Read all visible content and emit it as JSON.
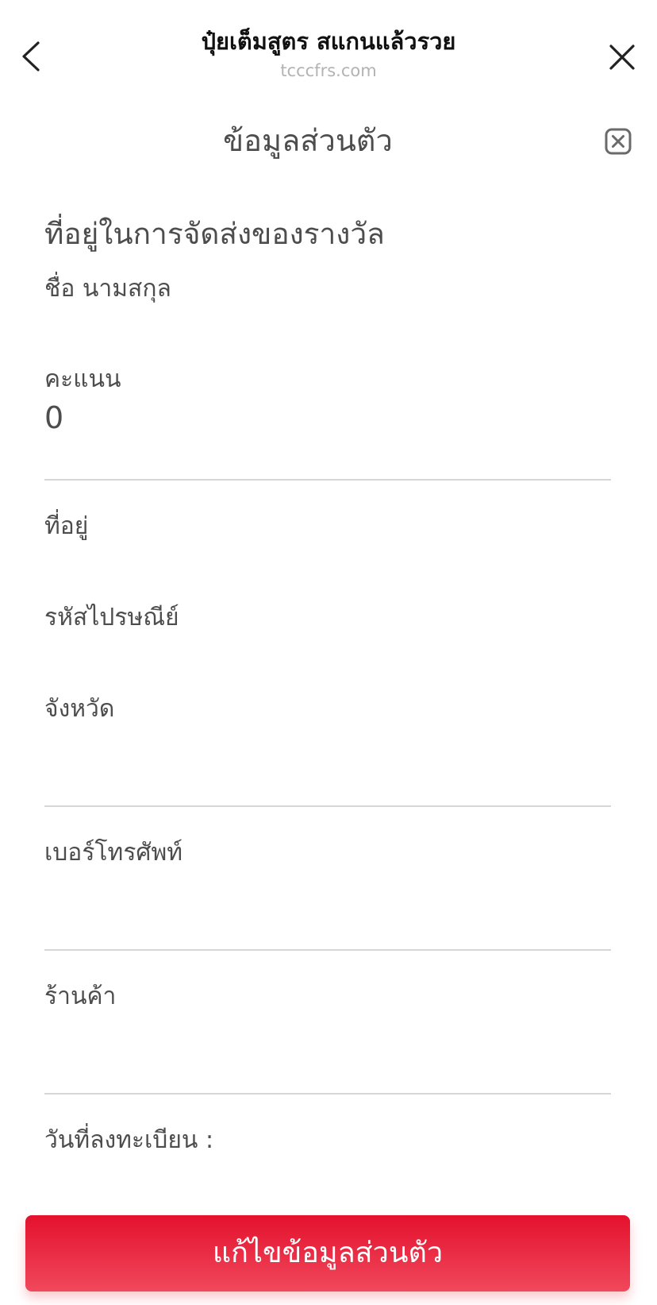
{
  "nav": {
    "title": "ปุ๋ยเต็มสูตร สแกนแล้วรวย",
    "url": "tcccfrs.com",
    "back_icon": "chevron-left-icon",
    "close_icon": "close-icon"
  },
  "section": {
    "title": "ข้อมูลส่วนตัว",
    "close_icon": "close-box-icon"
  },
  "shipping": {
    "heading": "ที่อยู่ในการจัดส่งของรางวัล",
    "name": "ชื่อ นามสกุล"
  },
  "fields": {
    "score_label": "คะแนน",
    "score_value": "0",
    "address_label": "ที่อยู่",
    "postal_label": "รหัสไปรษณีย์",
    "province_label": "จังหวัด",
    "phone_label": "เบอร์โทรศัพท์",
    "shop_label": "ร้านค้า",
    "register_date_label": "วันที่ลงทะเบียน :"
  },
  "actions": {
    "edit_label": "แก้ไขข้อมูลส่วนตัว"
  },
  "colors": {
    "accent_top": "#e4112d",
    "accent_bottom": "#f0485c",
    "divider": "#d6d6d6",
    "text": "#4d4d4d"
  }
}
